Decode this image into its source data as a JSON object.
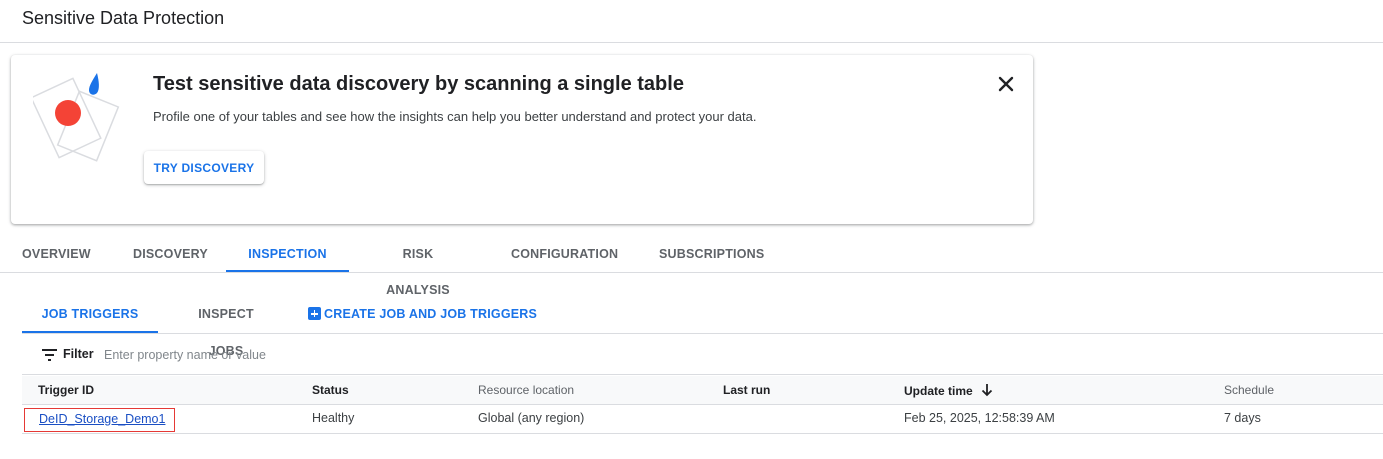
{
  "header": {
    "title": "Sensitive Data Protection"
  },
  "banner": {
    "title": "Test sensitive data discovery by scanning a single table",
    "description": "Profile one of your tables and see how the insights can help you better understand and protect your data.",
    "button_label": "TRY DISCOVERY",
    "illustration_colors": {
      "dot": "#f44336",
      "drop": "#1a73e8"
    }
  },
  "main_tabs": [
    {
      "label": "OVERVIEW",
      "active": false
    },
    {
      "label": "DISCOVERY",
      "active": false
    },
    {
      "label": "INSPECTION",
      "active": true
    },
    {
      "label": "RISK ANALYSIS",
      "active": false
    },
    {
      "label": "CONFIGURATION",
      "active": false
    },
    {
      "label": "SUBSCRIPTIONS",
      "active": false
    }
  ],
  "sub_tabs": [
    {
      "label": "JOB TRIGGERS",
      "active": true
    },
    {
      "label": "INSPECT JOBS",
      "active": false
    }
  ],
  "create_label": "CREATE JOB AND JOB TRIGGERS",
  "filter": {
    "label": "Filter",
    "placeholder": "Enter property name or value"
  },
  "table": {
    "columns": [
      "Trigger ID",
      "Status",
      "Resource location",
      "Last run",
      "Update time",
      "Schedule"
    ],
    "sort": {
      "column": "Update time",
      "direction": "descending"
    },
    "rows": [
      {
        "trigger_id": "DeID_Storage_Demo1",
        "status": "Healthy",
        "resource_location": "Global (any region)",
        "last_run": "",
        "update_time": "Feb 25, 2025, 12:58:39 AM",
        "schedule": "7 days"
      }
    ]
  },
  "colors": {
    "accent": "#1a73e8",
    "highlight_border": "#e53935"
  }
}
